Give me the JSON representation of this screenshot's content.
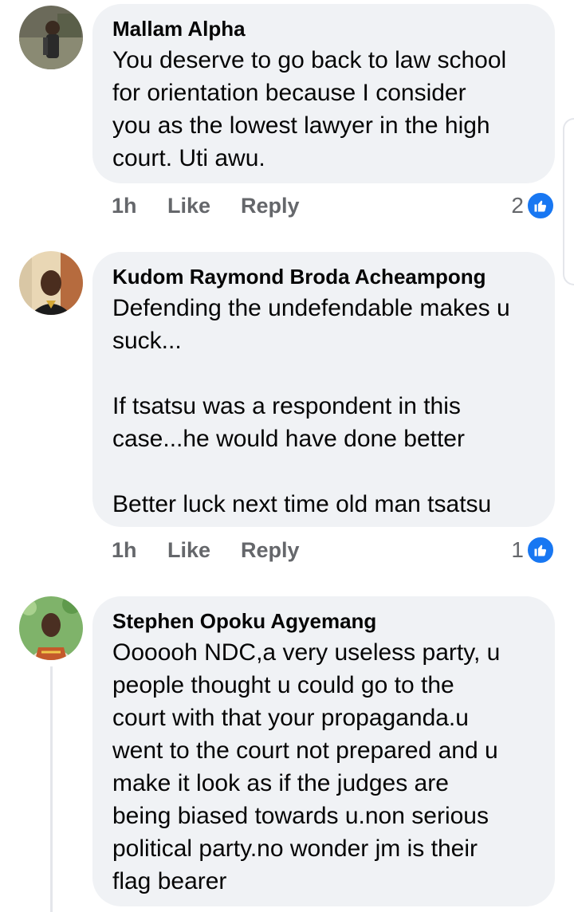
{
  "comments": [
    {
      "author": "Mallam Alpha",
      "text": "You deserve to go back to law school\nfor orientation because I consider\nyou as the lowest lawyer in the high\ncourt. Uti awu.",
      "time": "1h",
      "like_label": "Like",
      "reply_label": "Reply",
      "reaction_count": "2"
    },
    {
      "author": "Kudom Raymond Broda Acheampong",
      "text": "Defending the undefendable makes u\nsuck...\n\nIf tsatsu was a respondent in this\ncase...he would have done better\n\nBetter luck next time old man tsatsu",
      "time": "1h",
      "like_label": "Like",
      "reply_label": "Reply",
      "reaction_count": "1"
    },
    {
      "author": "Stephen Opoku Agyemang",
      "text": "Oooooh NDC,a very useless party, u\npeople thought u could go to the\ncourt with that your propaganda.u\nwent to the court not prepared and u\nmake it look as if the judges are\nbeing biased towards u.non serious\npolitical party.no wonder jm is their\nflag bearer"
    }
  ],
  "colors": {
    "bubble": "#f0f2f5",
    "meta_text": "#65676b",
    "like_blue": "#1877f2"
  },
  "icons": {
    "reaction": "thumbs-up-icon"
  }
}
